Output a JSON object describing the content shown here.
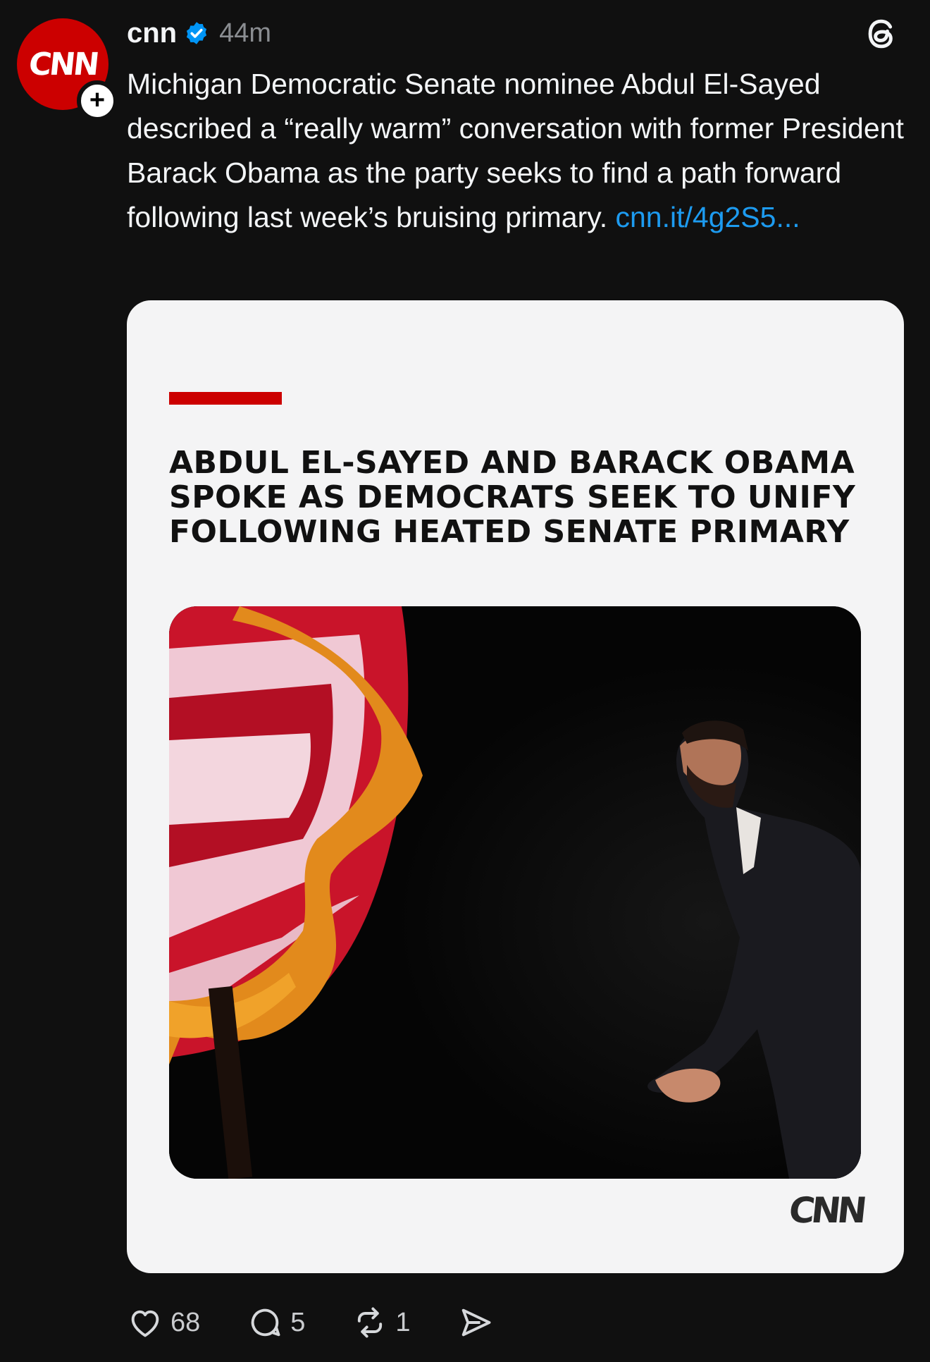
{
  "post": {
    "avatar_logo_text": "CNN",
    "username": "cnn",
    "timestamp": "44m",
    "caption_text": "Michigan Democratic Senate nominee Abdul El-Sayed described a “really warm” conversation with former President Barack Obama as the party seeks to find a path forward following last week’s bruising primary.",
    "caption_link": "cnn.it/4g2S5...",
    "icons": [
      "follow-plus-icon",
      "verified-badge-icon",
      "threads-logo-icon"
    ]
  },
  "card": {
    "headline_lines": [
      "ABDUL EL-SAYED AND BARACK OBAMA",
      "SPOKE AS DEMOCRATS SEEK TO UNIFY",
      "FOLLOWING HEATED SENATE PRIMARY"
    ],
    "brand_logo_text": "CNN",
    "accent_color": "#cc0000"
  },
  "actions": {
    "likes": "68",
    "replies": "5",
    "reposts": "1",
    "icons": [
      "heart-icon",
      "comment-icon",
      "repost-icon",
      "share-icon"
    ]
  },
  "colors": {
    "background": "#101010",
    "link": "#1d9bf0",
    "card_background": "#f4f4f5",
    "brand_red": "#cc0000"
  }
}
